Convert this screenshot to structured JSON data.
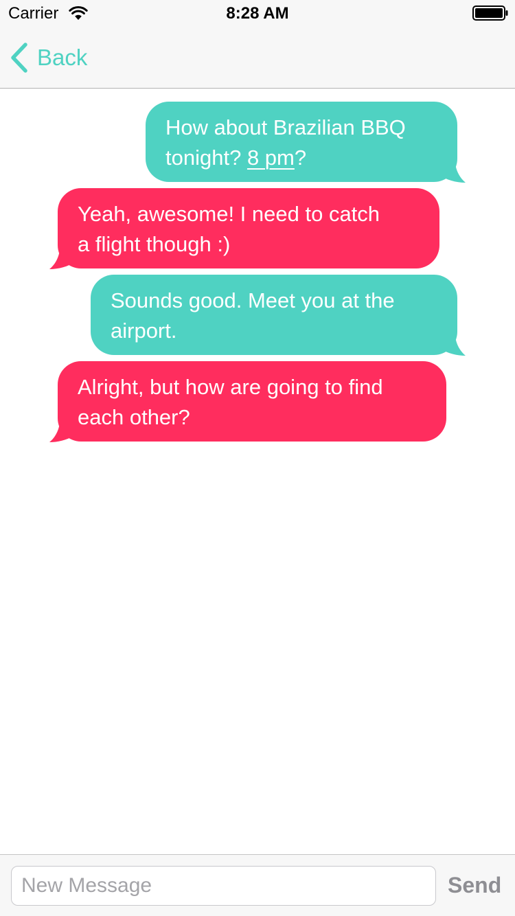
{
  "status_bar": {
    "carrier": "Carrier",
    "time": "8:28 AM",
    "wifi_icon": "wifi-icon",
    "battery_icon": "battery-full-icon"
  },
  "nav": {
    "back_label": "Back",
    "back_icon": "chevron-left-icon"
  },
  "messages": [
    {
      "direction": "outgoing",
      "line1": "How about Brazilian BBQ",
      "line2_prefix": "tonight? ",
      "link": "8 pm",
      "line2_suffix": "?"
    },
    {
      "direction": "incoming",
      "line1": "Yeah, awesome! I need to catch",
      "line2": "a flight though :)"
    },
    {
      "direction": "outgoing",
      "line1": "Sounds good. Meet you at the",
      "line2": "airport."
    },
    {
      "direction": "incoming",
      "line1": "Alright, but how are going to find",
      "line2": "each other?"
    }
  ],
  "composer": {
    "placeholder": "New Message",
    "value": "",
    "send_label": "Send"
  },
  "colors": {
    "accent": "#4fd2c2",
    "outgoing_bubble": "#4fd2c2",
    "incoming_bubble": "#ff2d5e",
    "send_disabled": "#8e8e93"
  }
}
